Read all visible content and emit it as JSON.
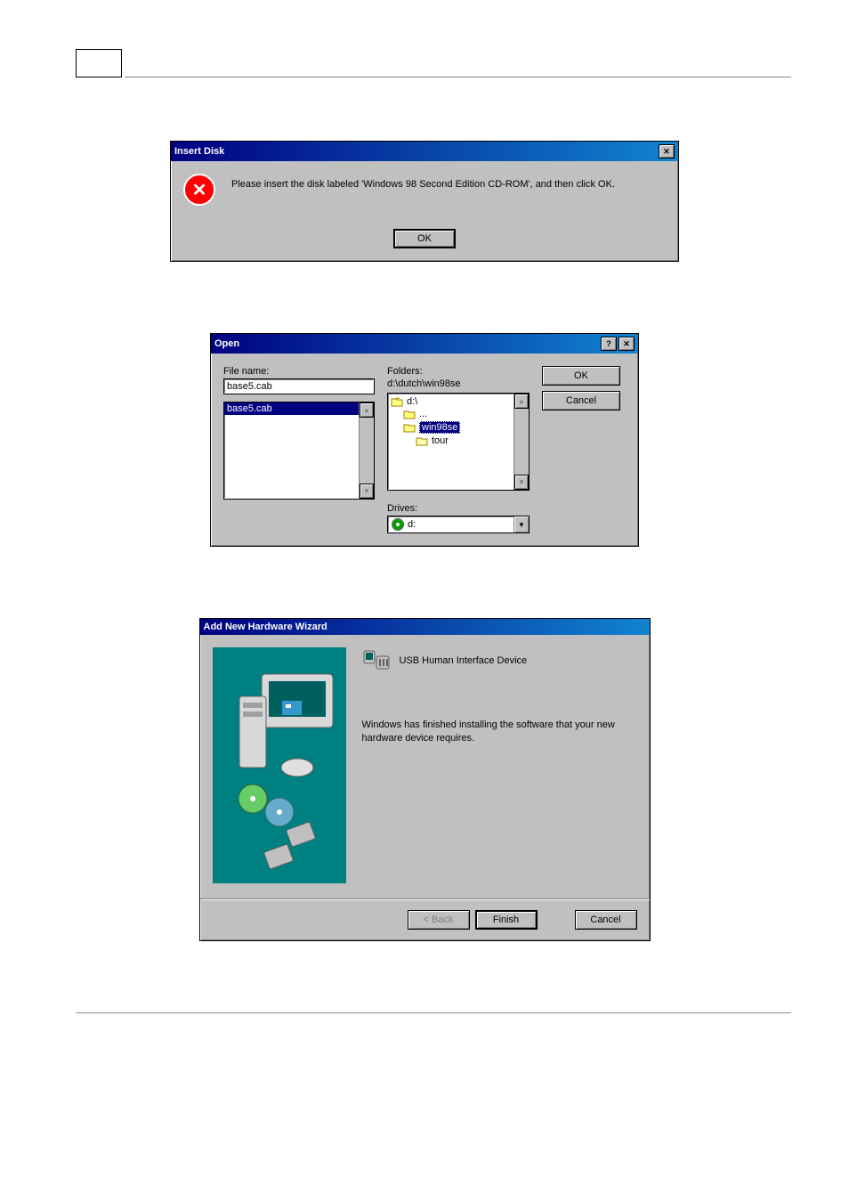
{
  "dialog1": {
    "title": "Insert Disk",
    "message": "Please insert the disk labeled 'Windows 98 Second Edition CD-ROM', and then click OK.",
    "ok": "OK"
  },
  "dialog2": {
    "title": "Open",
    "file_name_label": "File name:",
    "file_name_value": "base5.cab",
    "folders_label": "Folders:",
    "current_path": "d:\\dutch\\win98se",
    "file_list": [
      "base5.cab"
    ],
    "folder_tree": [
      {
        "label": "d:\\",
        "indent": 0,
        "open": true
      },
      {
        "label": "...",
        "indent": 1,
        "open": true
      },
      {
        "label": "win98se",
        "indent": 1,
        "open": true,
        "selected": true
      },
      {
        "label": "tour",
        "indent": 2,
        "open": false
      }
    ],
    "drives_label": "Drives:",
    "drive_selected": "d:",
    "ok": "OK",
    "cancel": "Cancel"
  },
  "dialog3": {
    "title": "Add New Hardware Wizard",
    "device_name": "USB Human Interface Device",
    "description": "Windows has finished installing the software that your new hardware device requires.",
    "back": "< Back",
    "finish": "Finish",
    "cancel": "Cancel"
  }
}
